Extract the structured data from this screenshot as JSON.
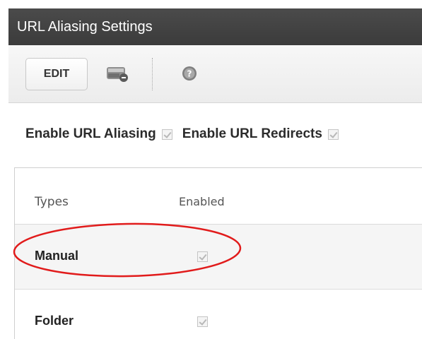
{
  "window": {
    "title": "URL Aliasing Settings"
  },
  "toolbar": {
    "edit_label": "EDIT",
    "save_icon": "save-disk-icon",
    "help_icon": "help-icon"
  },
  "options": {
    "enable_aliasing_label": "Enable URL Aliasing",
    "enable_aliasing_checked": true,
    "enable_redirects_label": "Enable URL Redirects",
    "enable_redirects_checked": true
  },
  "types_table": {
    "headers": {
      "types": "Types",
      "enabled": "Enabled"
    },
    "rows": [
      {
        "name": "Manual",
        "enabled": true,
        "highlighted": true
      },
      {
        "name": "Folder",
        "enabled": true,
        "highlighted": false
      }
    ]
  },
  "annotation": {
    "highlight_color": "#e11b1b"
  }
}
